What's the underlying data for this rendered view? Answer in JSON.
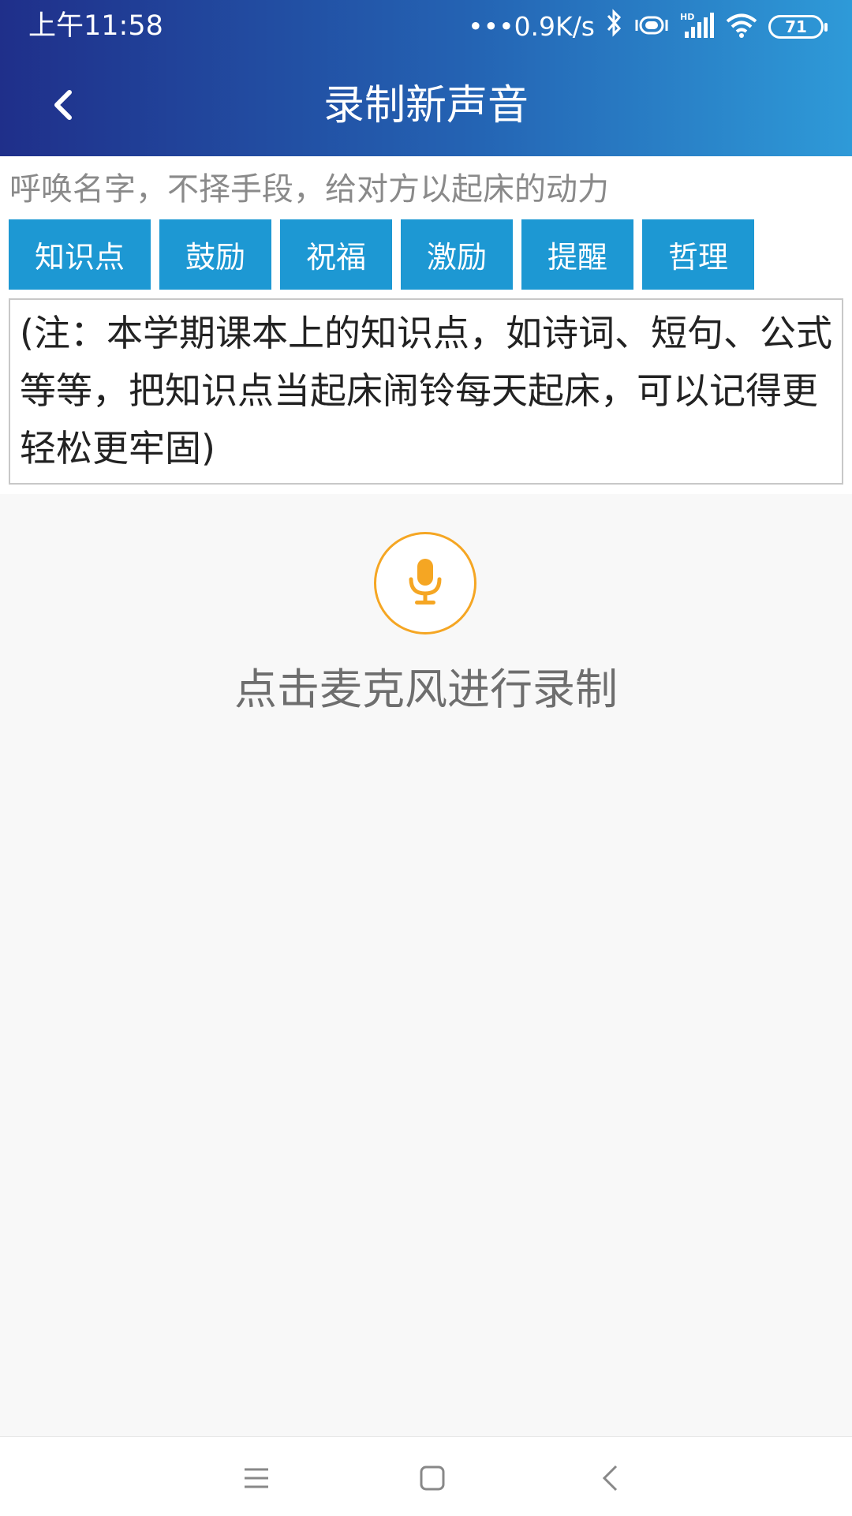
{
  "status_bar": {
    "time": "上午11:58",
    "network_speed": "•••0.9K/s",
    "battery_level": "71",
    "icons": [
      "bluetooth-icon",
      "vibrate-icon",
      "hd-signal-icon",
      "wifi-icon",
      "battery-icon"
    ]
  },
  "header": {
    "title": "录制新声音",
    "back_icon": "chevron-left-icon",
    "gradient_colors": [
      "#1f2f8a",
      "#2e9ad8"
    ]
  },
  "hint_text": "呼唤名字，不择手段，给对方以起床的动力",
  "tags": [
    {
      "label": "知识点"
    },
    {
      "label": "鼓励"
    },
    {
      "label": "祝福"
    },
    {
      "label": "激励"
    },
    {
      "label": "提醒"
    },
    {
      "label": "哲理"
    }
  ],
  "tag_color": "#1d98d3",
  "note_text": "(注：本学期课本上的知识点，如诗词、短句、公式等等，把知识点当起床闹铃每天起床，可以记得更轻松更牢固)",
  "record": {
    "mic_icon": "microphone-icon",
    "accent_color": "#f5a623",
    "hint": "点击麦克风进行录制"
  },
  "nav_bar": {
    "icons": [
      "menu-icon",
      "home-square-icon",
      "back-triangle-icon"
    ]
  }
}
